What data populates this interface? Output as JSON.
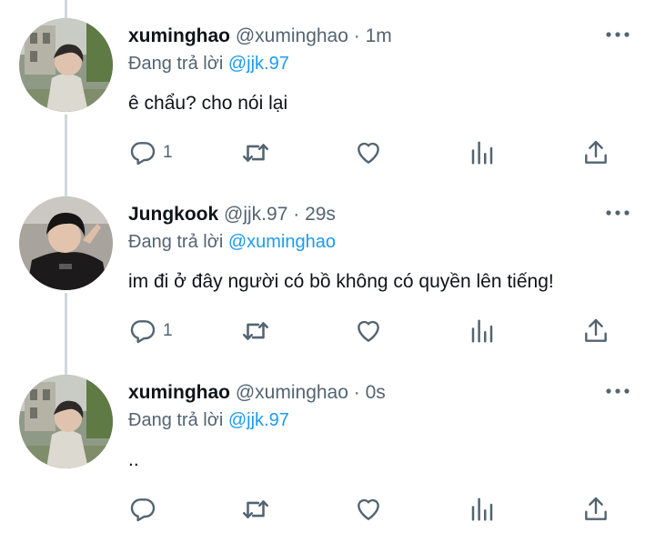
{
  "tweets": [
    {
      "display_name": "xuminghao",
      "handle": "@xuminghao",
      "separator": "·",
      "time": "1m",
      "reply_prefix": "Đang trả lời",
      "reply_to": "@jjk.97",
      "text": "ê chẩu? cho nói lại",
      "reply_count": "1",
      "avatar": "xuminghao-avatar"
    },
    {
      "display_name": "Jungkook",
      "handle": "@jjk.97",
      "separator": "·",
      "time": "29s",
      "reply_prefix": "Đang trả lời",
      "reply_to": "@xuminghao",
      "text": "im đi ở đây người có bồ không có quyền lên tiếng!",
      "reply_count": "1",
      "avatar": "jungkook-avatar"
    },
    {
      "display_name": "xuminghao",
      "handle": "@xuminghao",
      "separator": "·",
      "time": "0s",
      "reply_prefix": "Đang trả lời",
      "reply_to": "@jjk.97",
      "text": "..",
      "reply_count": "",
      "avatar": "xuminghao-avatar"
    }
  ],
  "icons": {
    "reply": "reply-icon",
    "retweet": "retweet-icon",
    "like": "heart-icon",
    "views": "analytics-icon",
    "share": "share-icon",
    "more": "more-icon"
  },
  "colors": {
    "mention": "#1d9bf0",
    "secondary_text": "#536471",
    "primary_text": "#0f1419",
    "thread_line": "#cfd9de"
  }
}
